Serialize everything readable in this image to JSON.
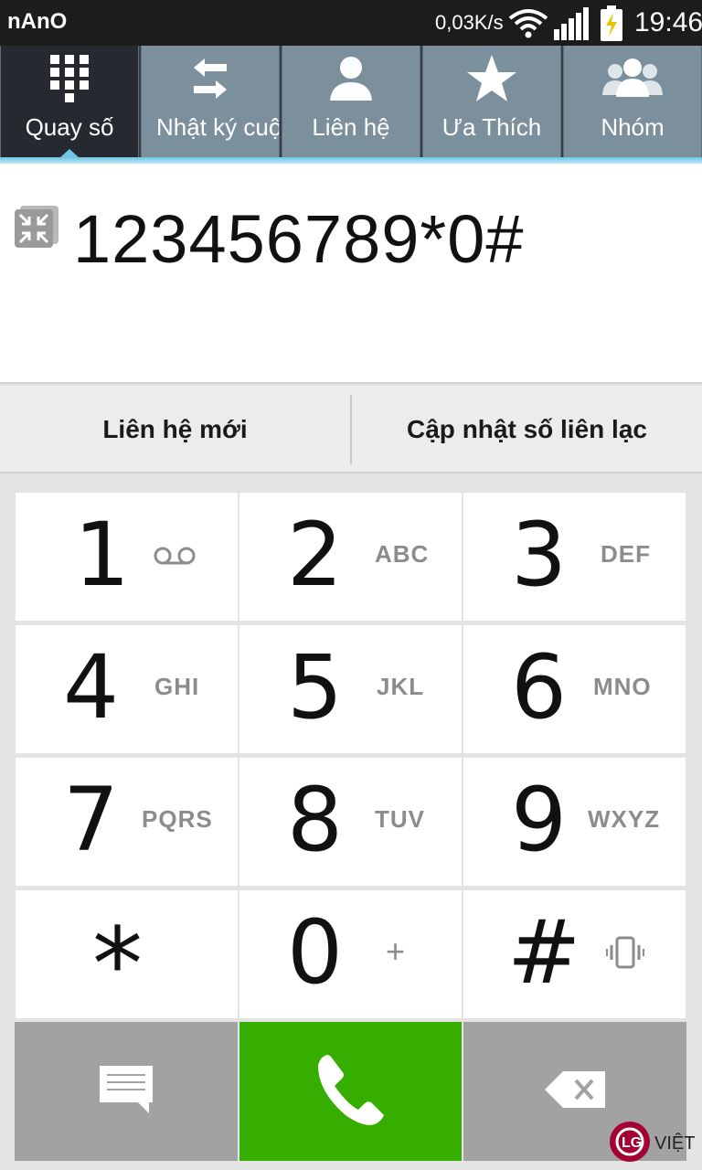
{
  "status_bar": {
    "carrier": "nAnO",
    "net_speed": "0,03K/s",
    "time": "19:46",
    "wifi_icon": "wifi-icon",
    "signal_icon": "signal-bars-icon",
    "battery_icon": "battery-charging-icon"
  },
  "tabs": [
    {
      "label": "Quay số",
      "icon": "dialpad-icon",
      "active": true
    },
    {
      "label": "Nhật ký cuộc gọi",
      "icon": "call-log-arrows-icon",
      "active": false
    },
    {
      "label": "Liên hệ",
      "icon": "contact-person-icon",
      "active": false
    },
    {
      "label": "Ưa Thích",
      "icon": "star-icon",
      "active": false
    },
    {
      "label": "Nhóm",
      "icon": "group-icon",
      "active": false
    }
  ],
  "display": {
    "number": "123456789*0#",
    "collapse_icon": "collapse-arrows-icon"
  },
  "actions": {
    "new_contact": "Liên hệ mới",
    "update_contact": "Cập nhật số liên lạc"
  },
  "keypad": [
    {
      "digit": "1",
      "letters": "",
      "sub_icon": "voicemail-icon"
    },
    {
      "digit": "2",
      "letters": "ABC"
    },
    {
      "digit": "3",
      "letters": "DEF"
    },
    {
      "digit": "4",
      "letters": "GHI"
    },
    {
      "digit": "5",
      "letters": "JKL"
    },
    {
      "digit": "6",
      "letters": "MNO"
    },
    {
      "digit": "7",
      "letters": "PQRS"
    },
    {
      "digit": "8",
      "letters": "TUV"
    },
    {
      "digit": "9",
      "letters": "WXYZ"
    },
    {
      "digit": "*",
      "letters": ""
    },
    {
      "digit": "0",
      "letters": "+"
    },
    {
      "digit": "#",
      "letters": "",
      "sub_icon": "vibrate-icon"
    }
  ],
  "bottom": {
    "message_icon": "message-icon",
    "call_icon": "phone-call-icon",
    "delete_icon": "backspace-icon"
  },
  "watermark": {
    "logo": "LG",
    "text": "VIỆT"
  },
  "colors": {
    "call_green": "#36ae00",
    "tab_active": "#262a30",
    "tab_inactive": "#7b8f9d",
    "accent_blue": "#6ec6e6"
  }
}
